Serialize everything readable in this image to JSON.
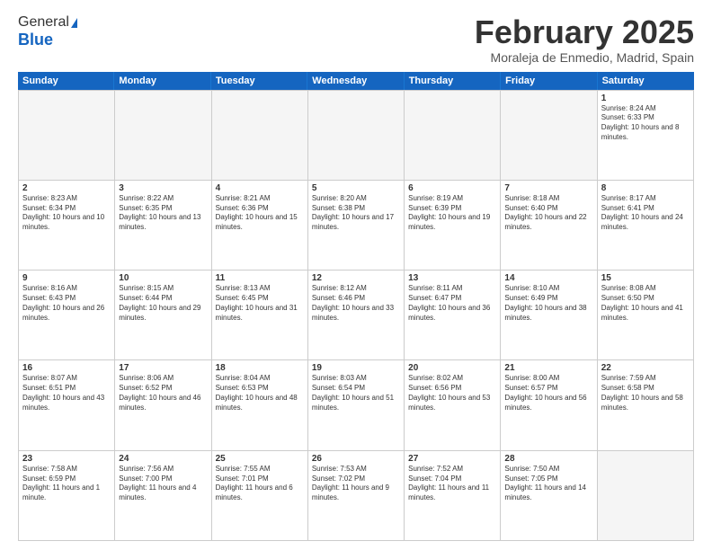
{
  "logo": {
    "general": "General",
    "blue": "Blue"
  },
  "header": {
    "month": "February 2025",
    "location": "Moraleja de Enmedio, Madrid, Spain"
  },
  "weekdays": [
    "Sunday",
    "Monday",
    "Tuesday",
    "Wednesday",
    "Thursday",
    "Friday",
    "Saturday"
  ],
  "weeks": [
    [
      {
        "day": "",
        "empty": true
      },
      {
        "day": "",
        "empty": true
      },
      {
        "day": "",
        "empty": true
      },
      {
        "day": "",
        "empty": true
      },
      {
        "day": "",
        "empty": true
      },
      {
        "day": "",
        "empty": true
      },
      {
        "day": "1",
        "sunrise": "Sunrise: 8:24 AM",
        "sunset": "Sunset: 6:33 PM",
        "daylight": "Daylight: 10 hours and 8 minutes."
      }
    ],
    [
      {
        "day": "2",
        "sunrise": "Sunrise: 8:23 AM",
        "sunset": "Sunset: 6:34 PM",
        "daylight": "Daylight: 10 hours and 10 minutes."
      },
      {
        "day": "3",
        "sunrise": "Sunrise: 8:22 AM",
        "sunset": "Sunset: 6:35 PM",
        "daylight": "Daylight: 10 hours and 13 minutes."
      },
      {
        "day": "4",
        "sunrise": "Sunrise: 8:21 AM",
        "sunset": "Sunset: 6:36 PM",
        "daylight": "Daylight: 10 hours and 15 minutes."
      },
      {
        "day": "5",
        "sunrise": "Sunrise: 8:20 AM",
        "sunset": "Sunset: 6:38 PM",
        "daylight": "Daylight: 10 hours and 17 minutes."
      },
      {
        "day": "6",
        "sunrise": "Sunrise: 8:19 AM",
        "sunset": "Sunset: 6:39 PM",
        "daylight": "Daylight: 10 hours and 19 minutes."
      },
      {
        "day": "7",
        "sunrise": "Sunrise: 8:18 AM",
        "sunset": "Sunset: 6:40 PM",
        "daylight": "Daylight: 10 hours and 22 minutes."
      },
      {
        "day": "8",
        "sunrise": "Sunrise: 8:17 AM",
        "sunset": "Sunset: 6:41 PM",
        "daylight": "Daylight: 10 hours and 24 minutes."
      }
    ],
    [
      {
        "day": "9",
        "sunrise": "Sunrise: 8:16 AM",
        "sunset": "Sunset: 6:43 PM",
        "daylight": "Daylight: 10 hours and 26 minutes."
      },
      {
        "day": "10",
        "sunrise": "Sunrise: 8:15 AM",
        "sunset": "Sunset: 6:44 PM",
        "daylight": "Daylight: 10 hours and 29 minutes."
      },
      {
        "day": "11",
        "sunrise": "Sunrise: 8:13 AM",
        "sunset": "Sunset: 6:45 PM",
        "daylight": "Daylight: 10 hours and 31 minutes."
      },
      {
        "day": "12",
        "sunrise": "Sunrise: 8:12 AM",
        "sunset": "Sunset: 6:46 PM",
        "daylight": "Daylight: 10 hours and 33 minutes."
      },
      {
        "day": "13",
        "sunrise": "Sunrise: 8:11 AM",
        "sunset": "Sunset: 6:47 PM",
        "daylight": "Daylight: 10 hours and 36 minutes."
      },
      {
        "day": "14",
        "sunrise": "Sunrise: 8:10 AM",
        "sunset": "Sunset: 6:49 PM",
        "daylight": "Daylight: 10 hours and 38 minutes."
      },
      {
        "day": "15",
        "sunrise": "Sunrise: 8:08 AM",
        "sunset": "Sunset: 6:50 PM",
        "daylight": "Daylight: 10 hours and 41 minutes."
      }
    ],
    [
      {
        "day": "16",
        "sunrise": "Sunrise: 8:07 AM",
        "sunset": "Sunset: 6:51 PM",
        "daylight": "Daylight: 10 hours and 43 minutes."
      },
      {
        "day": "17",
        "sunrise": "Sunrise: 8:06 AM",
        "sunset": "Sunset: 6:52 PM",
        "daylight": "Daylight: 10 hours and 46 minutes."
      },
      {
        "day": "18",
        "sunrise": "Sunrise: 8:04 AM",
        "sunset": "Sunset: 6:53 PM",
        "daylight": "Daylight: 10 hours and 48 minutes."
      },
      {
        "day": "19",
        "sunrise": "Sunrise: 8:03 AM",
        "sunset": "Sunset: 6:54 PM",
        "daylight": "Daylight: 10 hours and 51 minutes."
      },
      {
        "day": "20",
        "sunrise": "Sunrise: 8:02 AM",
        "sunset": "Sunset: 6:56 PM",
        "daylight": "Daylight: 10 hours and 53 minutes."
      },
      {
        "day": "21",
        "sunrise": "Sunrise: 8:00 AM",
        "sunset": "Sunset: 6:57 PM",
        "daylight": "Daylight: 10 hours and 56 minutes."
      },
      {
        "day": "22",
        "sunrise": "Sunrise: 7:59 AM",
        "sunset": "Sunset: 6:58 PM",
        "daylight": "Daylight: 10 hours and 58 minutes."
      }
    ],
    [
      {
        "day": "23",
        "sunrise": "Sunrise: 7:58 AM",
        "sunset": "Sunset: 6:59 PM",
        "daylight": "Daylight: 11 hours and 1 minute."
      },
      {
        "day": "24",
        "sunrise": "Sunrise: 7:56 AM",
        "sunset": "Sunset: 7:00 PM",
        "daylight": "Daylight: 11 hours and 4 minutes."
      },
      {
        "day": "25",
        "sunrise": "Sunrise: 7:55 AM",
        "sunset": "Sunset: 7:01 PM",
        "daylight": "Daylight: 11 hours and 6 minutes."
      },
      {
        "day": "26",
        "sunrise": "Sunrise: 7:53 AM",
        "sunset": "Sunset: 7:02 PM",
        "daylight": "Daylight: 11 hours and 9 minutes."
      },
      {
        "day": "27",
        "sunrise": "Sunrise: 7:52 AM",
        "sunset": "Sunset: 7:04 PM",
        "daylight": "Daylight: 11 hours and 11 minutes."
      },
      {
        "day": "28",
        "sunrise": "Sunrise: 7:50 AM",
        "sunset": "Sunset: 7:05 PM",
        "daylight": "Daylight: 11 hours and 14 minutes."
      },
      {
        "day": "",
        "empty": true
      }
    ]
  ]
}
